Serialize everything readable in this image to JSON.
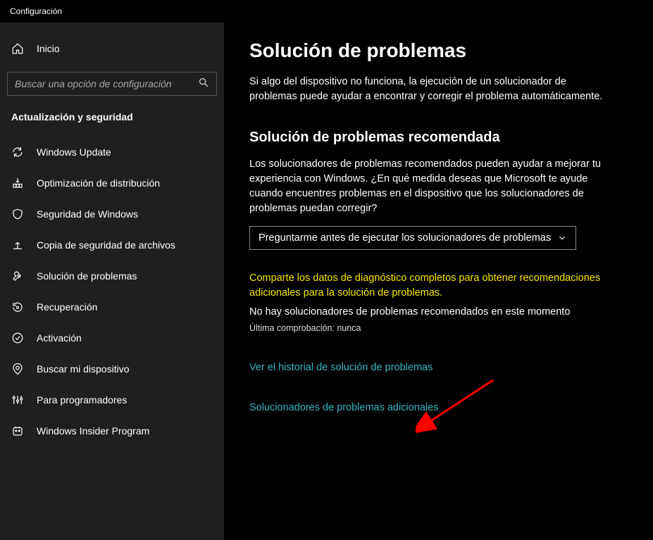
{
  "window": {
    "title": "Configuración"
  },
  "sidebar": {
    "home_label": "Inicio",
    "search_placeholder": "Buscar una opción de configuración",
    "section_title": "Actualización y seguridad",
    "items": [
      {
        "label": "Windows Update"
      },
      {
        "label": "Optimización de distribución"
      },
      {
        "label": "Seguridad de Windows"
      },
      {
        "label": "Copia de seguridad de archivos"
      },
      {
        "label": "Solución de problemas"
      },
      {
        "label": "Recuperación"
      },
      {
        "label": "Activación"
      },
      {
        "label": "Buscar mi dispositivo"
      },
      {
        "label": "Para programadores"
      },
      {
        "label": "Windows Insider Program"
      }
    ]
  },
  "main": {
    "title": "Solución de problemas",
    "intro": "Si algo del dispositivo no funciona, la ejecución de un solucionador de problemas puede ayudar a encontrar y corregir el problema automáticamente.",
    "section_title": "Solución de problemas recomendada",
    "section_body": "Los solucionadores de problemas recomendados pueden ayudar a mejorar tu experiencia con Windows. ¿En qué medida deseas que Microsoft te ayude cuando encuentres problemas en el dispositivo que los solucionadores de problemas puedan corregir?",
    "select_value": "Preguntarme antes de ejecutar los solucionadores de problemas",
    "diag_link": "Comparte los datos de diagnóstico completos para obtener recomendaciones adicionales para la solución de problemas.",
    "no_recommend": "No hay solucionadores de problemas recomendados en este momento",
    "last_check": "Última comprobación: nunca",
    "history_link": "Ver el historial de solución de problemas",
    "additional_link": "Solucionadores de problemas adicionales"
  }
}
